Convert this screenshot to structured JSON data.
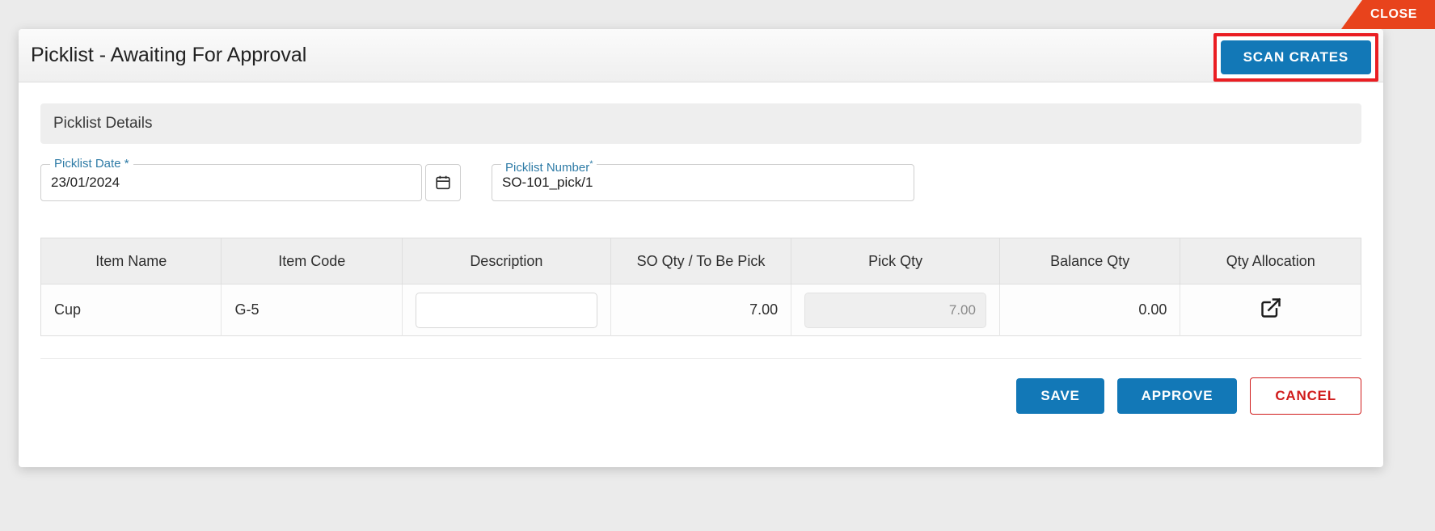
{
  "close_tab": {
    "label": "CLOSE",
    "color": "#e8431c"
  },
  "dialog": {
    "title": "Picklist - Awaiting For Approval",
    "scan_crates_label": "SCAN CRATES",
    "highlight_color": "#ea1d22",
    "primary_color": "#1278b7"
  },
  "section": {
    "title": "Picklist Details"
  },
  "form": {
    "picklist_date": {
      "label": "Picklist Date *",
      "value": "23/01/2024",
      "placeholder": "",
      "icon": "calendar-icon"
    },
    "picklist_number": {
      "label": "Picklist Number",
      "required_mark": "*",
      "value": "SO-101_pick/1",
      "placeholder": ""
    }
  },
  "table": {
    "columns": [
      "Item Name",
      "Item Code",
      "Description",
      "SO Qty / To Be Pick",
      "Pick Qty",
      "Balance Qty",
      "Qty Allocation"
    ],
    "rows": [
      {
        "item_name": "Cup",
        "item_code": "G-5",
        "description": "",
        "description_placeholder": "",
        "so_qty": "7.00",
        "pick_qty": "7.00",
        "balance_qty": "0.00",
        "qty_allocation_icon": "external-link-icon"
      }
    ]
  },
  "footer": {
    "save_label": "SAVE",
    "approve_label": "APPROVE",
    "cancel_label": "CANCEL",
    "cancel_color": "#d01b1b"
  }
}
